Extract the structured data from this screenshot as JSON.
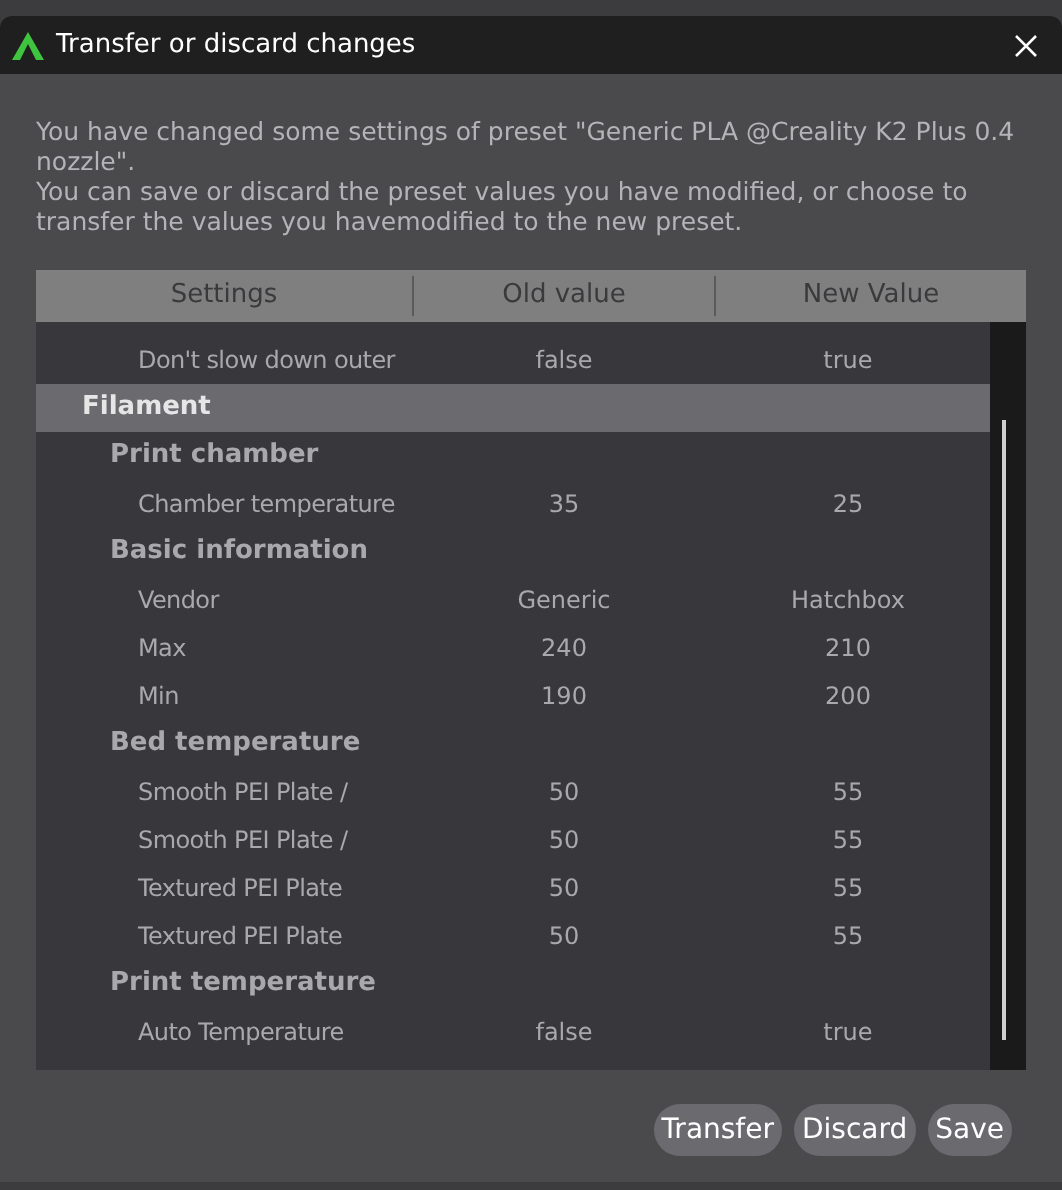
{
  "window": {
    "title": "Transfer or discard changes"
  },
  "message": [
    "You have changed some settings of preset \"Generic PLA @Creality K2 Plus 0.4 nozzle\".",
    "You can save or discard the preset values you have modified, or choose to transfer the values you havemodified to the new preset."
  ],
  "table": {
    "columns": [
      "Settings",
      "Old value",
      "New Value"
    ],
    "rows": [
      {
        "kind": "setting",
        "label": "Don't slow down outer",
        "old": "false",
        "new": "true"
      },
      {
        "kind": "category",
        "label": "Filament",
        "children": [
          {
            "kind": "group",
            "label": "Print chamber",
            "children": [
              {
                "kind": "setting",
                "label": "Chamber temperature",
                "old": "35",
                "new": "25"
              }
            ]
          },
          {
            "kind": "group",
            "label": "Basic information",
            "children": [
              {
                "kind": "setting",
                "label": "Vendor",
                "old": "Generic",
                "new": "Hatchbox"
              },
              {
                "kind": "setting",
                "label": "Max",
                "old": "240",
                "new": "210"
              },
              {
                "kind": "setting",
                "label": "Min",
                "old": "190",
                "new": "200"
              }
            ]
          },
          {
            "kind": "group",
            "label": "Bed temperature",
            "children": [
              {
                "kind": "setting",
                "label": "Smooth PEI Plate /",
                "old": "50",
                "new": "55"
              },
              {
                "kind": "setting",
                "label": "Smooth PEI Plate /",
                "old": "50",
                "new": "55"
              },
              {
                "kind": "setting",
                "label": "Textured PEI Plate",
                "old": "50",
                "new": "55"
              },
              {
                "kind": "setting",
                "label": "Textured PEI Plate",
                "old": "50",
                "new": "55"
              }
            ]
          },
          {
            "kind": "group",
            "label": "Print temperature",
            "children": [
              {
                "kind": "setting",
                "label": "Auto Temperature",
                "old": "false",
                "new": "true"
              }
            ]
          }
        ]
      }
    ]
  },
  "buttons": [
    "Transfer",
    "Discard",
    "Save"
  ]
}
